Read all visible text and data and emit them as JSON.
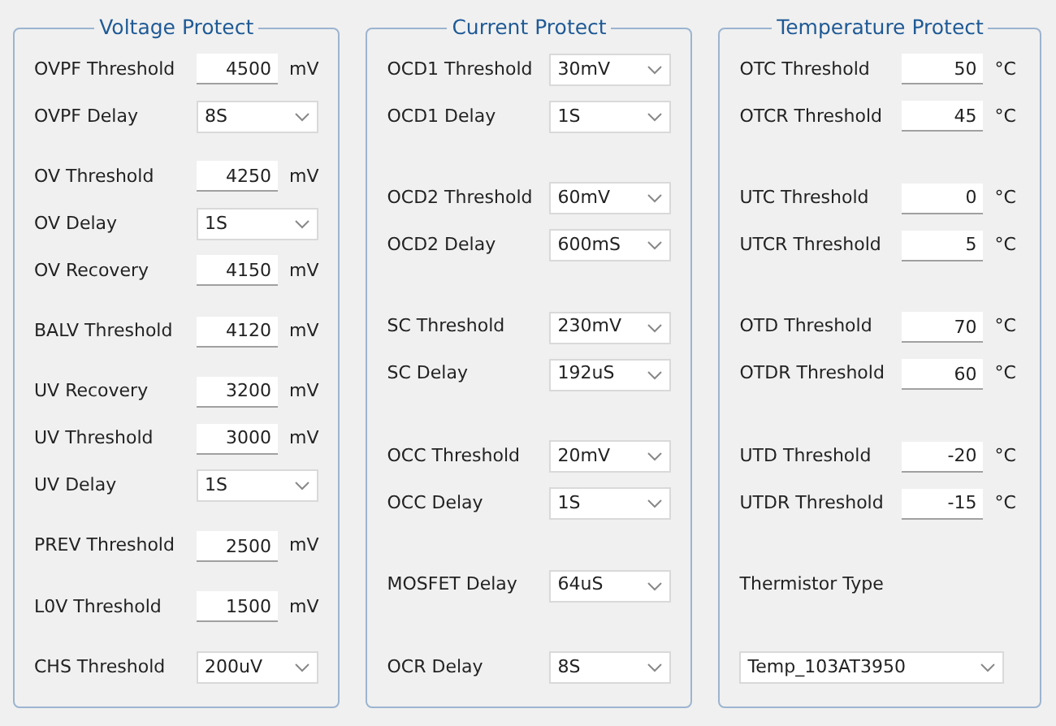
{
  "panels": [
    {
      "title": "Voltage Protect",
      "groups": [
        [
          {
            "kind": "input",
            "label": "OVPF Threshold",
            "value": "4500",
            "unit": "mV"
          },
          {
            "kind": "select",
            "label": "OVPF Delay",
            "value": "8S"
          }
        ],
        [
          {
            "kind": "input",
            "label": "OV Threshold",
            "value": "4250",
            "unit": "mV"
          },
          {
            "kind": "select",
            "label": "OV Delay",
            "value": "1S"
          },
          {
            "kind": "input",
            "label": "OV Recovery",
            "value": "4150",
            "unit": "mV"
          }
        ],
        [
          {
            "kind": "input",
            "label": "BALV Threshold",
            "value": "4120",
            "unit": "mV"
          }
        ],
        [
          {
            "kind": "input",
            "label": "UV Recovery",
            "value": "3200",
            "unit": "mV"
          },
          {
            "kind": "input",
            "label": "UV Threshold",
            "value": "3000",
            "unit": "mV"
          },
          {
            "kind": "select",
            "label": "UV Delay",
            "value": "1S"
          }
        ],
        [
          {
            "kind": "input",
            "label": "PREV Threshold",
            "value": "2500",
            "unit": "mV"
          }
        ],
        [
          {
            "kind": "input",
            "label": "L0V Threshold",
            "value": "1500",
            "unit": "mV"
          }
        ],
        [
          {
            "kind": "select",
            "label": "CHS Threshold",
            "value": "200uV"
          }
        ]
      ]
    },
    {
      "title": "Current Protect",
      "groups": [
        [
          {
            "kind": "select",
            "label": "OCD1 Threshold",
            "value": "30mV"
          },
          {
            "kind": "select",
            "label": "OCD1 Delay",
            "value": "1S"
          }
        ],
        [
          {
            "kind": "select",
            "label": "OCD2 Threshold",
            "value": "60mV"
          },
          {
            "kind": "select",
            "label": "OCD2 Delay",
            "value": "600mS"
          }
        ],
        [
          {
            "kind": "select",
            "label": "SC Threshold",
            "value": "230mV"
          },
          {
            "kind": "select",
            "label": "SC Delay",
            "value": "192uS"
          }
        ],
        [
          {
            "kind": "select",
            "label": "OCC Threshold",
            "value": "20mV"
          },
          {
            "kind": "select",
            "label": "OCC Delay",
            "value": "1S"
          }
        ],
        [
          {
            "kind": "select",
            "label": "MOSFET Delay",
            "value": "64uS"
          }
        ],
        [
          {
            "kind": "select",
            "label": "OCR Delay",
            "value": "8S"
          }
        ]
      ]
    },
    {
      "title": "Temperature Protect",
      "groups": [
        [
          {
            "kind": "input",
            "label": "OTC Threshold",
            "value": "50",
            "unit": "°C"
          },
          {
            "kind": "input",
            "label": "OTCR Threshold",
            "value": "45",
            "unit": "°C"
          }
        ],
        [
          {
            "kind": "input",
            "label": "UTC Threshold",
            "value": "0",
            "unit": "°C"
          },
          {
            "kind": "input",
            "label": "UTCR Threshold",
            "value": "5",
            "unit": "°C"
          }
        ],
        [
          {
            "kind": "input",
            "label": "OTD Threshold",
            "value": "70",
            "unit": "°C"
          },
          {
            "kind": "input",
            "label": "OTDR Threshold",
            "value": "60",
            "unit": "°C"
          }
        ],
        [
          {
            "kind": "input",
            "label": "UTD Threshold",
            "value": "-20",
            "unit": "°C"
          },
          {
            "kind": "input",
            "label": "UTDR Threshold",
            "value": "-15",
            "unit": "°C"
          }
        ],
        [
          {
            "kind": "label",
            "label": "Thermistor Type"
          }
        ],
        [
          {
            "kind": "wide_select",
            "value": "Temp_103AT3950"
          }
        ]
      ]
    }
  ]
}
